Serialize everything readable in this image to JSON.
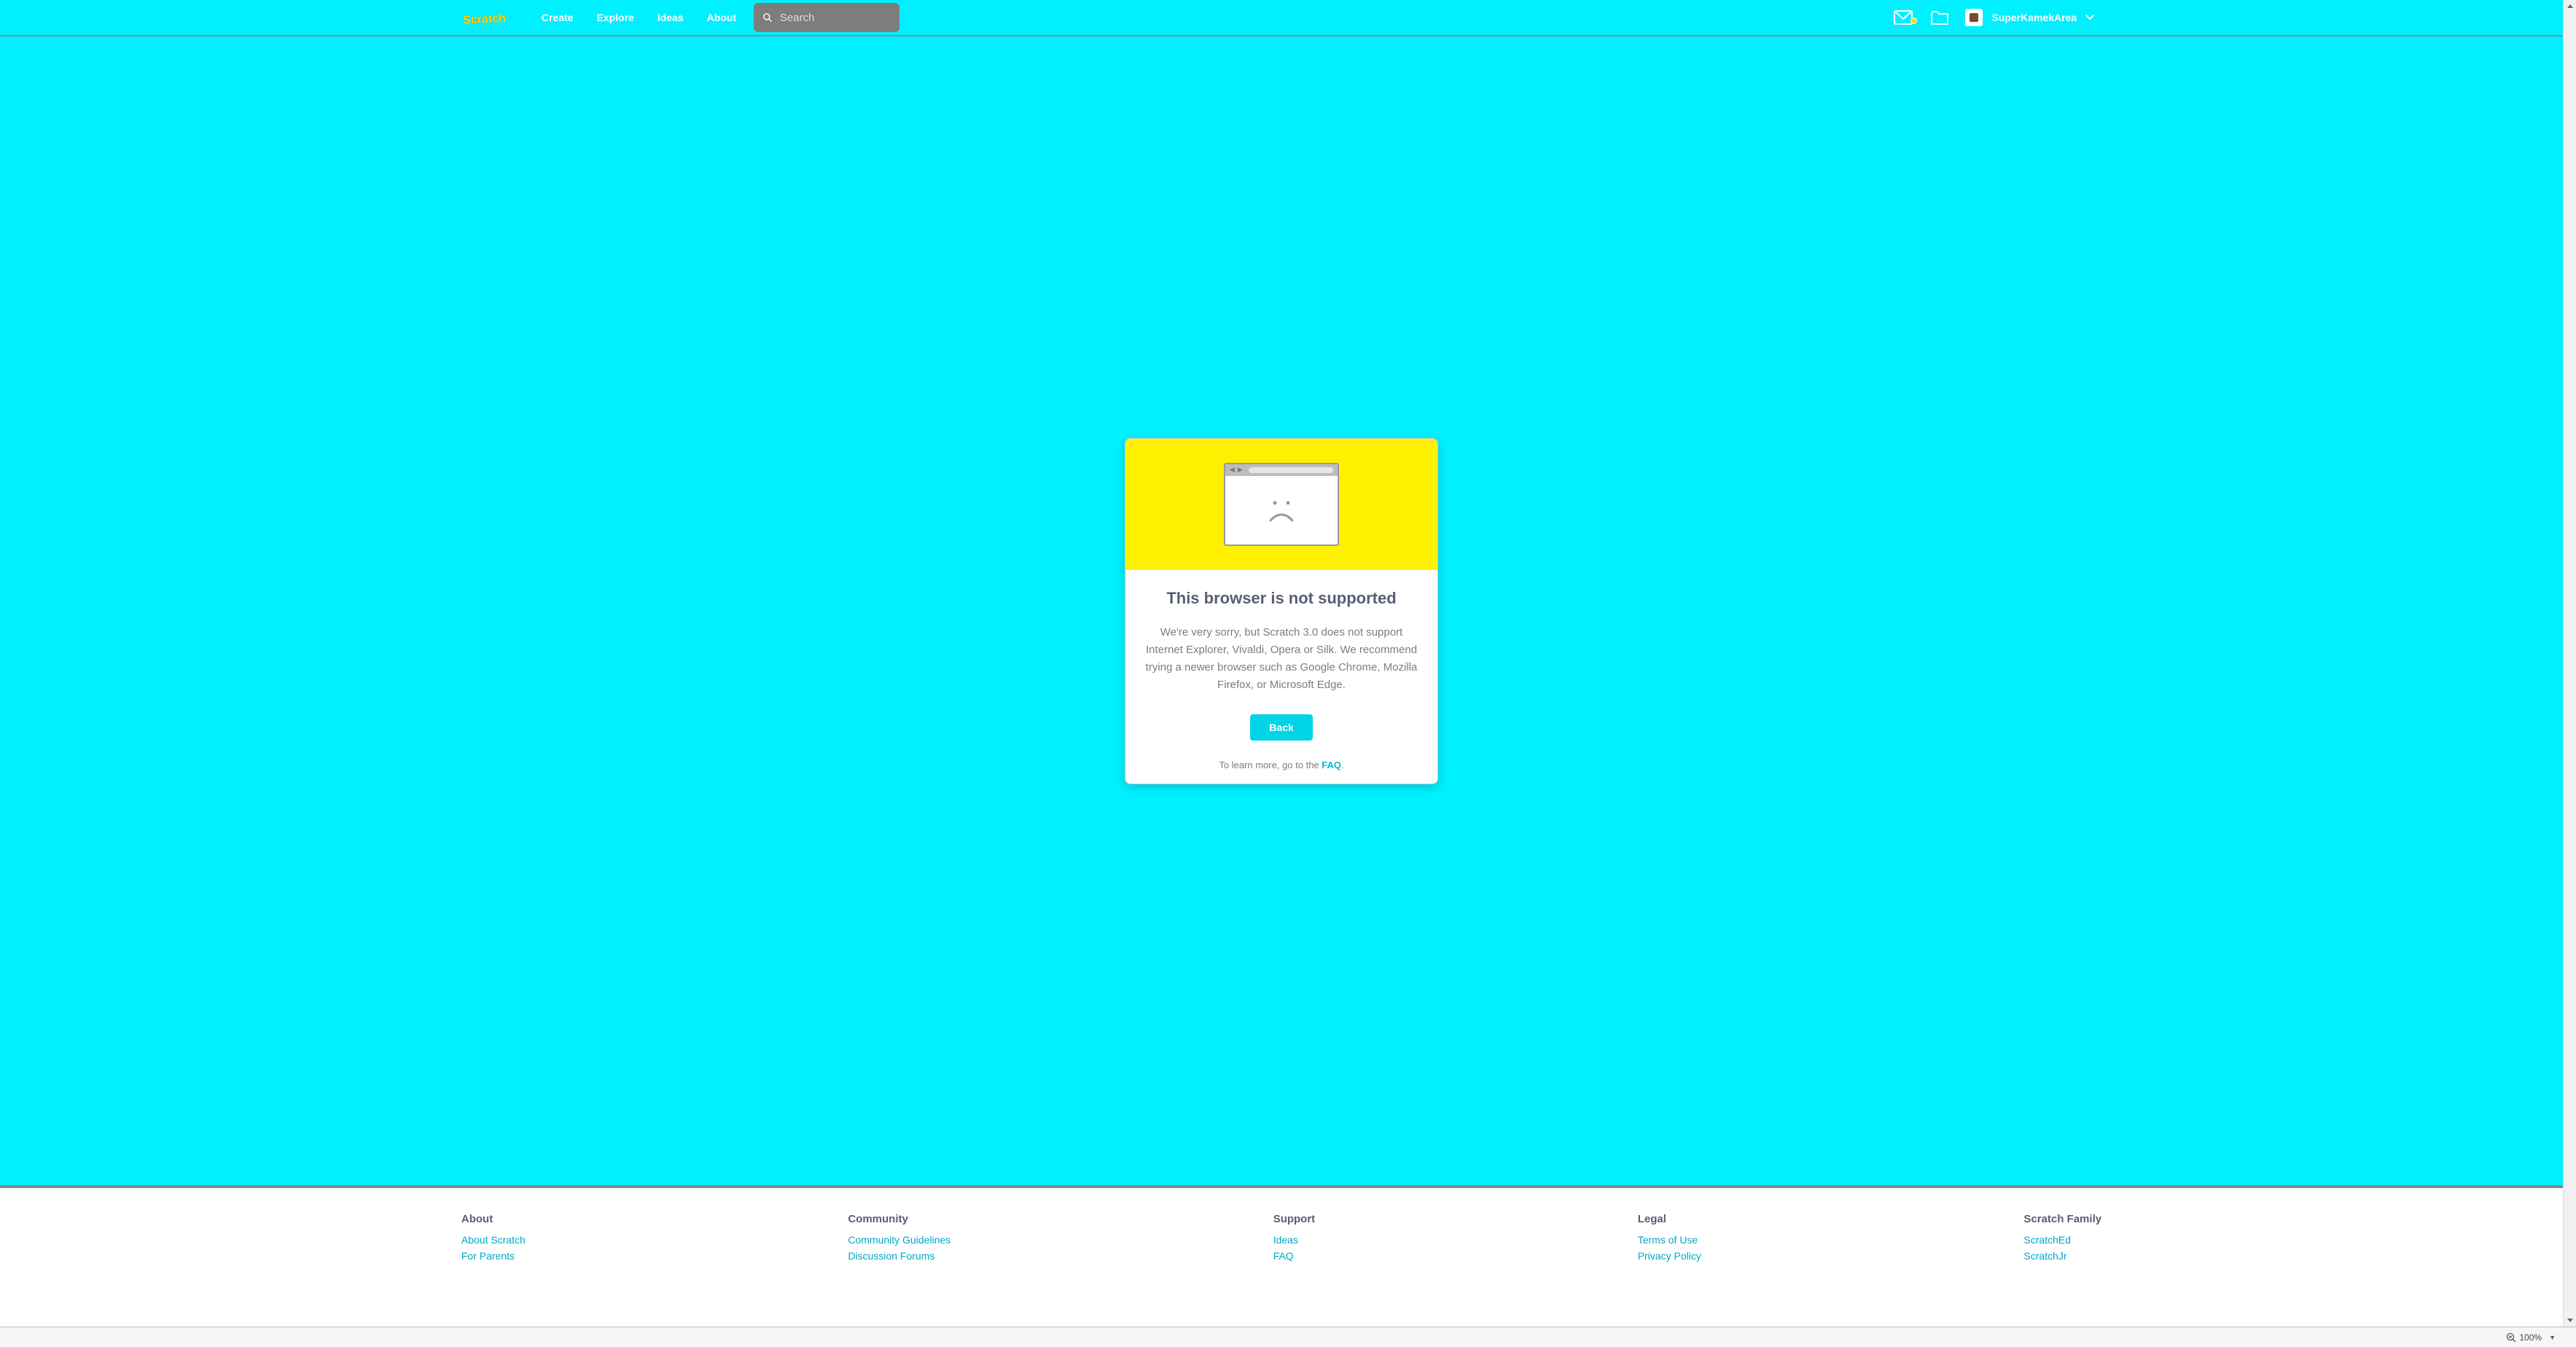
{
  "nav": {
    "logo_text": "SCRATCH",
    "links": [
      "Create",
      "Explore",
      "Ideas",
      "About"
    ],
    "search_placeholder": "Search",
    "username": "SuperKamekArea"
  },
  "card": {
    "title": "This browser is not supported",
    "body": "We're very sorry, but Scratch 3.0 does not support Internet Explorer, Vivaldi, Opera or Silk. We recommend trying a newer browser such as Google Chrome, Mozilla Firefox, or Microsoft Edge.",
    "back_label": "Back",
    "faq_prefix": "To learn more, go to the ",
    "faq_link": "FAQ",
    "faq_suffix": "."
  },
  "footer": {
    "cols": [
      {
        "title": "About",
        "links": [
          "About Scratch",
          "For Parents"
        ]
      },
      {
        "title": "Community",
        "links": [
          "Community Guidelines",
          "Discussion Forums"
        ]
      },
      {
        "title": "Support",
        "links": [
          "Ideas",
          "FAQ"
        ]
      },
      {
        "title": "Legal",
        "links": [
          "Terms of Use",
          "Privacy Policy"
        ]
      },
      {
        "title": "Scratch Family",
        "links": [
          "ScratchEd",
          "ScratchJr"
        ]
      }
    ]
  },
  "status": {
    "zoom": "100%"
  }
}
